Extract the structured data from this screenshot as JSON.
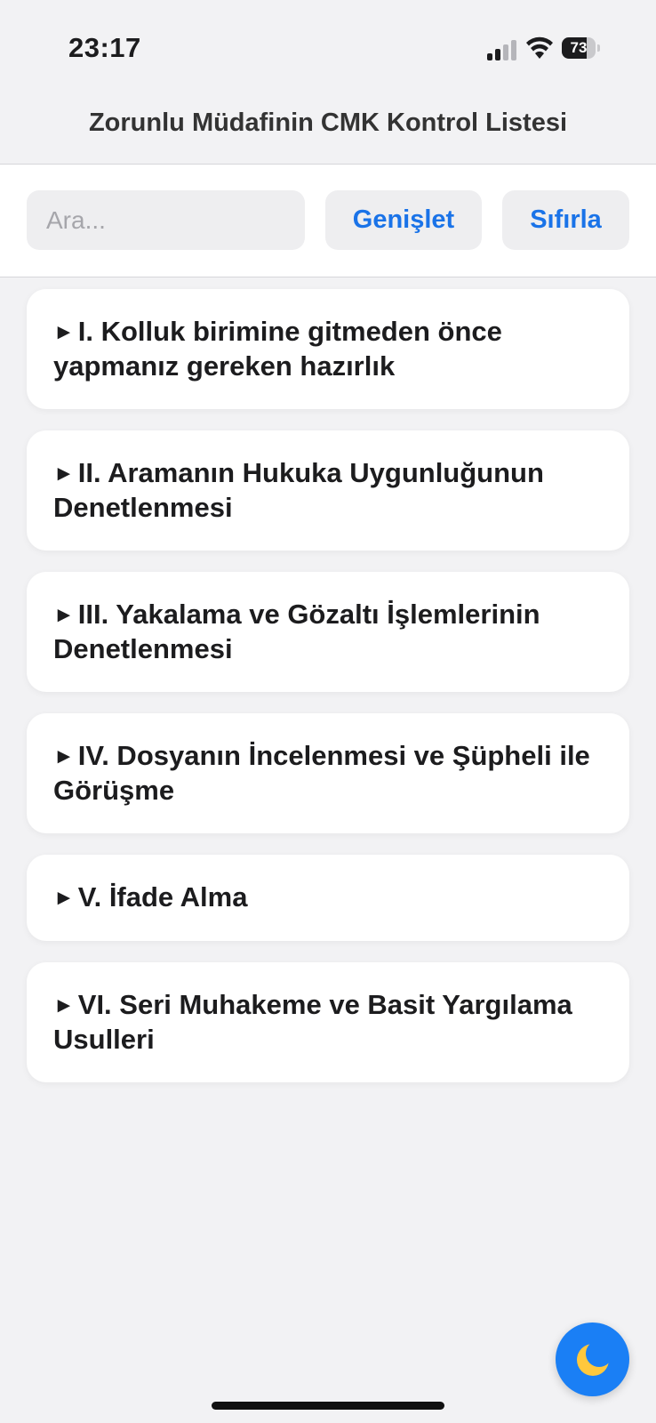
{
  "status_bar": {
    "time": "23:17",
    "battery_level": "73",
    "signal_bars_active": 2,
    "signal_bars_total": 4
  },
  "header": {
    "title": "Zorunlu Müdafinin CMK Kontrol Listesi"
  },
  "toolbar": {
    "search_placeholder": "Ara...",
    "expand_label": "Genişlet",
    "reset_label": "Sıfırla"
  },
  "sections": [
    {
      "arrow": "►",
      "label": "I. Kolluk birimine gitmeden önce yapmanız gereken hazırlık"
    },
    {
      "arrow": "►",
      "label": "II. Aramanın Hukuka Uygunluğunun Denetlenmesi"
    },
    {
      "arrow": "►",
      "label": "III. Yakalama ve Gözaltı İşlemlerinin Denetlenmesi"
    },
    {
      "arrow": "►",
      "label": "IV. Dosyanın İncelenmesi ve Şüpheli ile Görüşme"
    },
    {
      "arrow": "►",
      "label": "V. İfade Alma"
    },
    {
      "arrow": "►",
      "label": "VI. Seri Muhakeme ve Basit Yargılama Usulleri"
    }
  ],
  "fab": {
    "icon": "moon-icon",
    "glyph": "🌙"
  },
  "colors": {
    "accent": "#1a73e8",
    "fab": "#1a7ff5",
    "background": "#f2f2f4"
  }
}
